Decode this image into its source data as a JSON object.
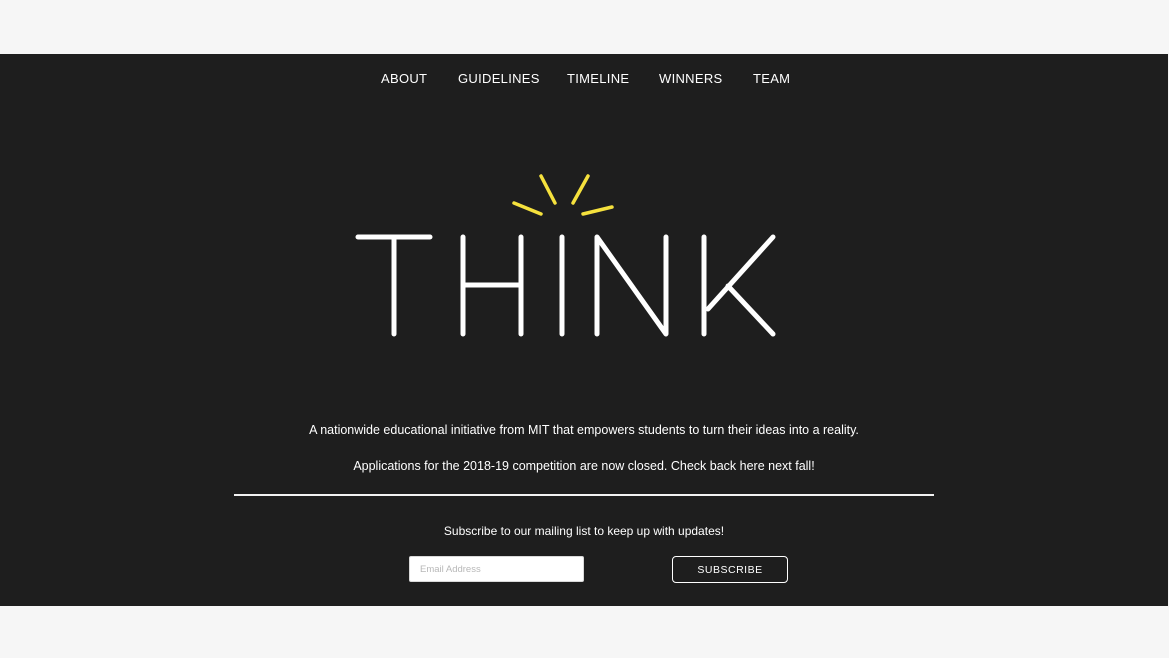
{
  "nav": {
    "items": [
      {
        "label": "ABOUT"
      },
      {
        "label": "GUIDELINES"
      },
      {
        "label": "TIMELINE"
      },
      {
        "label": "WINNERS"
      },
      {
        "label": "TEAM"
      }
    ]
  },
  "logo": {
    "wordmark": "THINK",
    "stroke_color": "#ffffff",
    "spark_color": "#f5e13d"
  },
  "hero": {
    "background_color": "#1e1e1e",
    "tagline": "A nationwide educational initiative from MIT that empowers students to turn their ideas into a reality.",
    "status": "Applications for the 2018-19 competition are now closed. Check back here next fall!"
  },
  "subscribe": {
    "note": "Subscribe to our mailing list to keep up with updates!",
    "email_value": "",
    "email_placeholder": "Email Address",
    "button_label": "SUBSCRIBE"
  }
}
